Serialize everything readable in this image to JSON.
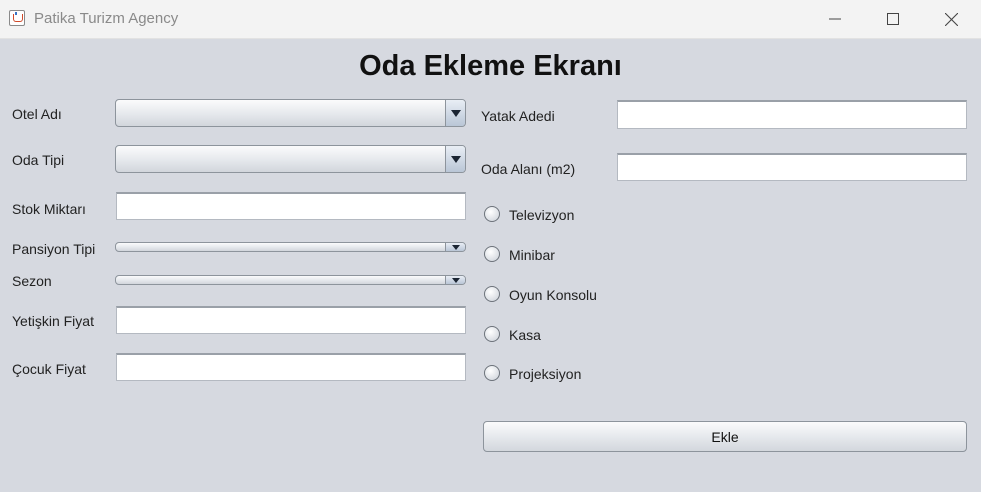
{
  "window": {
    "title": "Patika Turizm Agency",
    "controls": {
      "minimize": "—",
      "maximize": "☐",
      "close": "✕"
    }
  },
  "form": {
    "heading": "Oda Ekleme Ekranı",
    "labels": {
      "otel_adi": "Otel Adı",
      "oda_tipi": "Oda Tipi",
      "stok_miktari": "Stok Miktarı",
      "pansiyon_tipi": "Pansiyon Tipi",
      "sezon": "Sezon",
      "yetiskin_fiyat": "Yetişkin Fiyat",
      "cocuk_fiyat": "Çocuk Fiyat",
      "yatak_adedi": "Yatak Adedi",
      "oda_alani": "Oda Alanı (m2)"
    },
    "values": {
      "otel_adi": "",
      "oda_tipi": "",
      "pansiyon_tipi": "",
      "sezon": "",
      "stok_miktari": "",
      "yetiskin_fiyat": "",
      "cocuk_fiyat": "",
      "yatak_adedi": "",
      "oda_alani": ""
    },
    "features": [
      "Televizyon",
      "Minibar",
      "Oyun Konsolu",
      "Kasa",
      "Projeksiyon"
    ],
    "submit_label": "Ekle"
  }
}
